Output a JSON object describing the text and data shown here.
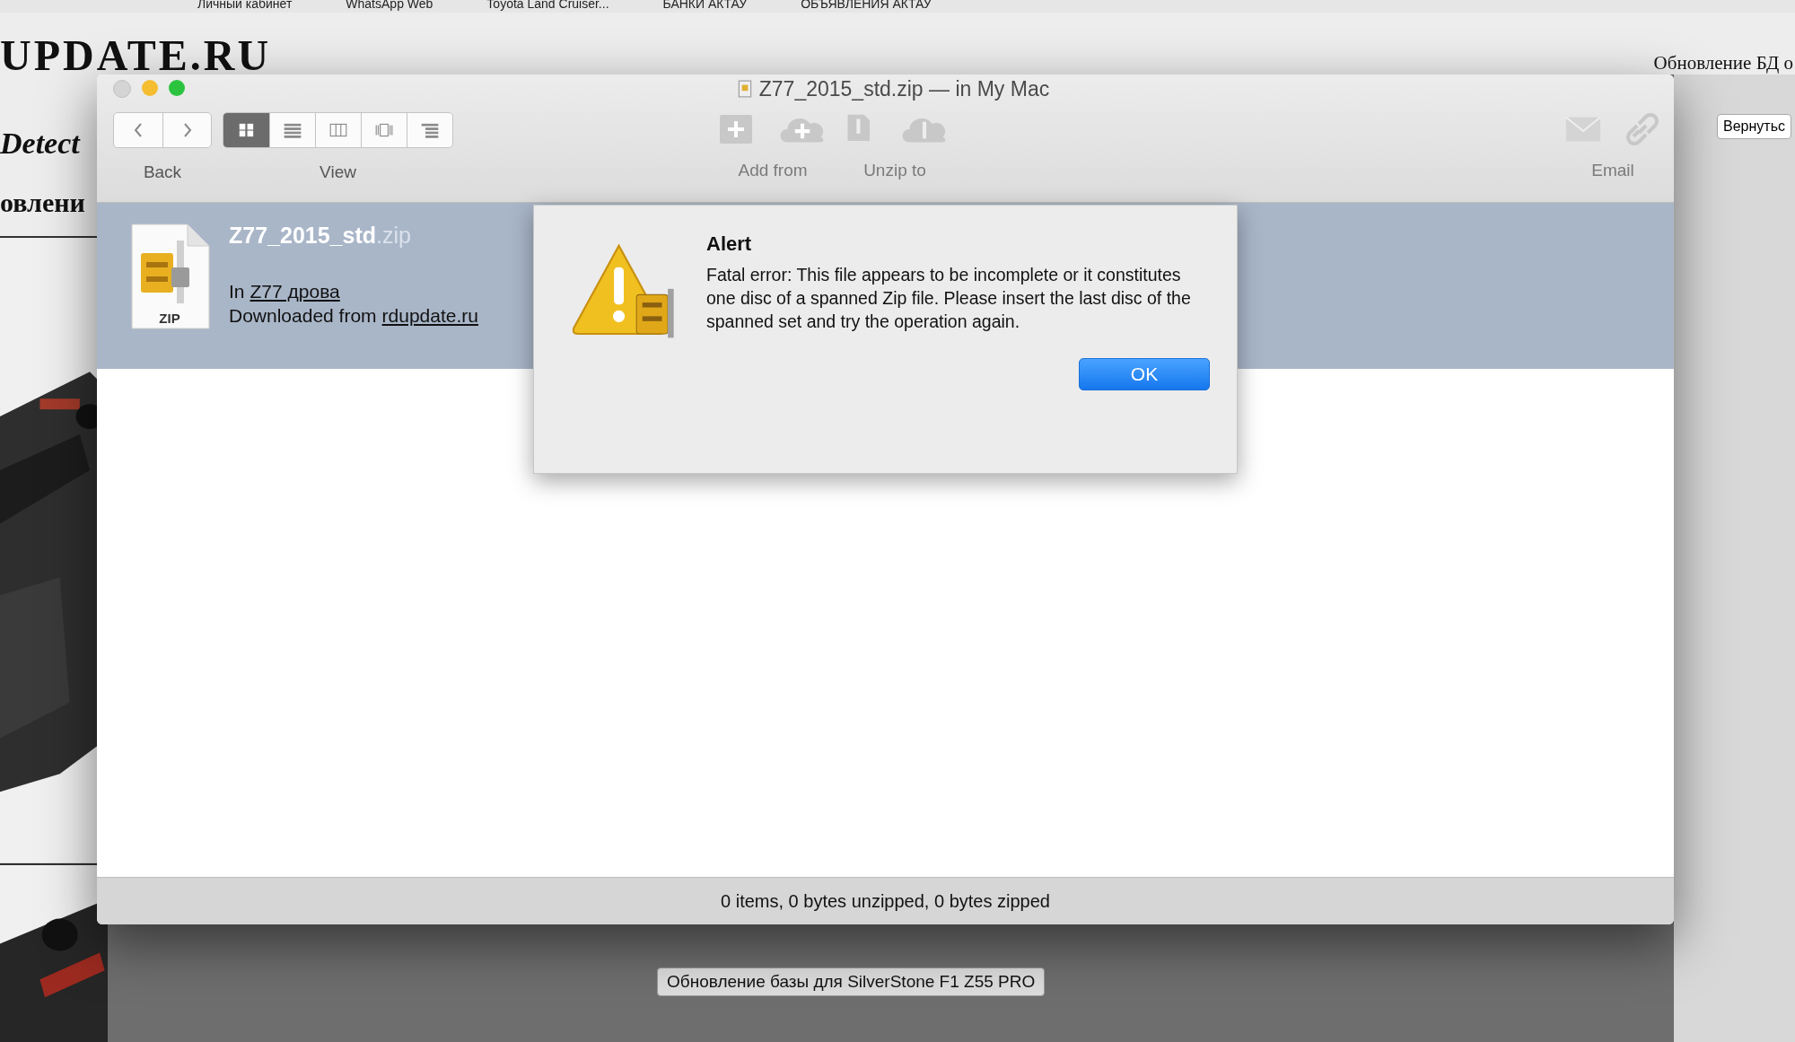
{
  "browser": {
    "bookmarks": [
      "Личный кабинет",
      "WhatsApp Web",
      "Toyota Land Cruiser...",
      "БАНКИ АКТАУ",
      "ОБЪЯВЛЕНИЯ АКТАУ"
    ]
  },
  "page": {
    "logo": "UPDATE.RU",
    "logo_sub": "Detect",
    "heading_left": "овлени",
    "heading_right": "Обновление БД о",
    "back_button": "Вернутьс",
    "footer_button": "Обновление базы для SilverStone F1 Z55 PRO"
  },
  "window": {
    "title": "Z77_2015_std.zip — in My Mac",
    "view_modes": [
      {
        "kind": "icons",
        "selected": true
      },
      {
        "kind": "list",
        "selected": false
      },
      {
        "kind": "columns",
        "selected": false
      },
      {
        "kind": "coverflow",
        "selected": false
      },
      {
        "kind": "outline",
        "selected": false
      }
    ],
    "toolbar": [
      {
        "label": "Back",
        "kind": "nav",
        "disabled": false
      },
      {
        "label": "View",
        "kind": "view",
        "disabled": false
      },
      {
        "label": "Add from",
        "kind": "add",
        "disabled": true
      },
      {
        "label": "Unzip to",
        "kind": "unzip",
        "disabled": true
      },
      {
        "label": "Email",
        "kind": "email",
        "disabled": true
      }
    ],
    "file": {
      "name": "Z77_2015_std",
      "extension": ".zip",
      "icon_label": "ZIP",
      "location_prefix": "In",
      "location": "Z77 дрова",
      "source_prefix": "Downloaded from",
      "source": "rdupdate.ru",
      "selected": true
    },
    "status_bar": "0 items, 0 bytes unzipped, 0 bytes zipped"
  },
  "alert": {
    "title": "Alert",
    "message": "Fatal error: This file appears to be incomplete or it constitutes one disc of a spanned Zip file. Please insert the last disc of the spanned set and try the operation again.",
    "buttons": [
      {
        "label": "OK",
        "default": true
      }
    ]
  }
}
